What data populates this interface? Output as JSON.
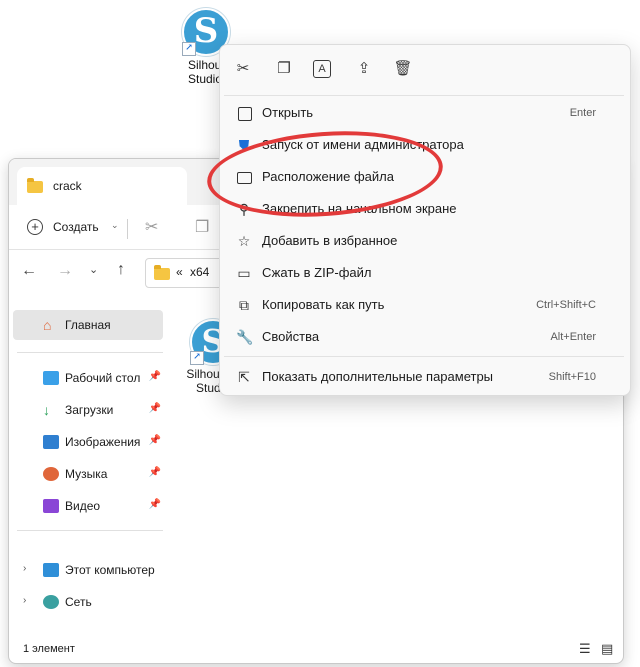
{
  "desktop": {
    "icon_label_line1": "Silhouette",
    "icon_label_line2": "Studio",
    "logo_letter": "S"
  },
  "explorer": {
    "tab_title": "crack",
    "toolbar": {
      "new_label": "Создать"
    },
    "address": {
      "breadcrumb_sep": "«",
      "path_segment": "x64"
    },
    "sidebar": {
      "home": "Главная",
      "quick": [
        {
          "label": "Рабочий стол",
          "color": "#3aa0e8"
        },
        {
          "label": "Загрузки",
          "color": "#2aa05a"
        },
        {
          "label": "Изображения",
          "color": "#2f7fd0"
        },
        {
          "label": "Музыка",
          "color": "#e0663a"
        },
        {
          "label": "Видео",
          "color": "#8a46d6"
        }
      ],
      "this_pc": "Этот компьютер",
      "network": "Сеть"
    },
    "file": {
      "label_line1": "Silhouette",
      "label_line2": "Studio"
    },
    "status": {
      "count": "1 элемент"
    }
  },
  "context_menu": {
    "top_actions": [
      "cut-icon",
      "copy-icon",
      "rename-icon",
      "share-icon",
      "delete-icon"
    ],
    "items": [
      {
        "label": "Открыть",
        "shortcut": "Enter",
        "icon": "open-icon"
      },
      {
        "label": "Запуск от имени администратора",
        "shortcut": "",
        "icon": "shield-icon"
      },
      {
        "label": "Расположение файла",
        "shortcut": "",
        "icon": "folder-open-icon"
      },
      {
        "label": "Закрепить на начальном экране",
        "shortcut": "",
        "icon": "pin-icon"
      },
      {
        "label": "Добавить в избранное",
        "shortcut": "",
        "icon": "star-icon"
      },
      {
        "label": "Сжать в ZIP-файл",
        "shortcut": "",
        "icon": "zip-icon"
      },
      {
        "label": "Копировать как путь",
        "shortcut": "Ctrl+Shift+C",
        "icon": "path-icon"
      },
      {
        "label": "Свойства",
        "shortcut": "Alt+Enter",
        "icon": "wrench-icon"
      },
      {
        "label": "Показать дополнительные параметры",
        "shortcut": "Shift+F10",
        "icon": "more-options-icon"
      }
    ]
  },
  "colors": {
    "accent": "#3b9fd4",
    "highlight": "#e23a3a",
    "selected_nav": "#e5e5e5"
  }
}
